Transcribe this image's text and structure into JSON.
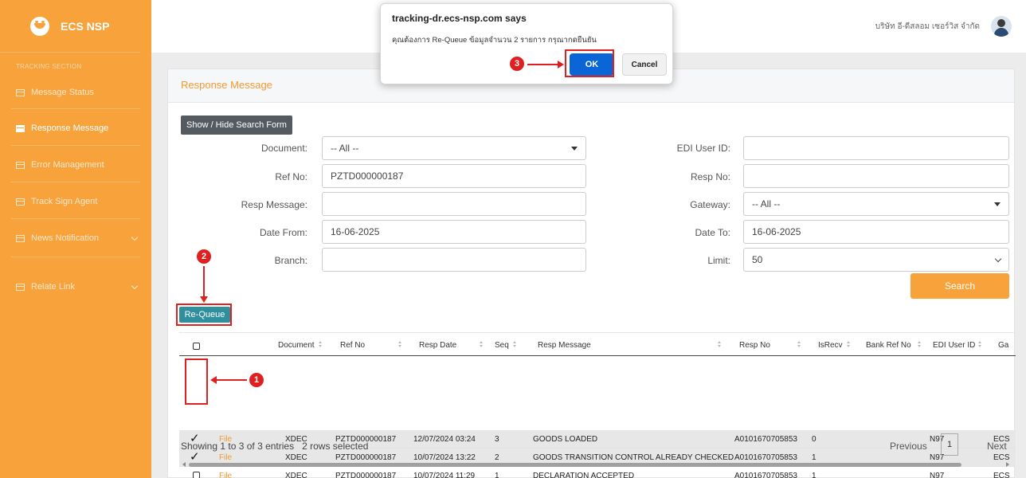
{
  "sidebar": {
    "brand": "ECS NSP",
    "section_title": "TRACKING SECTION",
    "items": [
      {
        "label": "Message Status"
      },
      {
        "label": "Response Message"
      },
      {
        "label": "Error Management"
      },
      {
        "label": "Track Sign Agent"
      },
      {
        "label": "News Notification"
      },
      {
        "label": "Relate Link"
      }
    ]
  },
  "header": {
    "company": "บริษัท อี-ดีสลอม เซอร์วิส จำกัด"
  },
  "card": {
    "title": "Response Message",
    "toggle_label": "Show / Hide Search Form"
  },
  "form": {
    "document": {
      "label": "Document:",
      "value": "-- All --"
    },
    "ref_no": {
      "label": "Ref No:",
      "value": "PZTD000000187"
    },
    "resp_message": {
      "label": "Resp Message:",
      "value": ""
    },
    "date_from": {
      "label": "Date From:",
      "value": "16-06-2025"
    },
    "branch": {
      "label": "Branch:",
      "value": ""
    },
    "edi_user_id": {
      "label": "EDI User ID:",
      "value": ""
    },
    "resp_no": {
      "label": "Resp No:",
      "value": ""
    },
    "gateway": {
      "label": "Gateway:",
      "value": "-- All --"
    },
    "date_to": {
      "label": "Date To:",
      "value": "16-06-2025"
    },
    "limit": {
      "label": "Limit:",
      "value": "50"
    },
    "search_label": "Search",
    "requeue_label": "Re-Queue"
  },
  "table": {
    "headers": {
      "document": "Document",
      "ref_no": "Ref No",
      "resp_date": "Resp Date",
      "seq": "Seq",
      "resp_message": "Resp Message",
      "resp_no": "Resp No",
      "isrecv": "IsRecv",
      "bank_ref_no": "Bank Ref No",
      "edi_user_id": "EDI User ID",
      "gateway": "Ga"
    },
    "rows": [
      {
        "link": "File",
        "document": "XDEC",
        "ref_no": "PZTD000000187",
        "resp_date": "12/07/2024 03:24",
        "seq": "3",
        "resp_message": "GOODS LOADED",
        "resp_no": "A0101670705853",
        "isrecv": "0",
        "bank_ref_no": "",
        "edi_user_id": "N97",
        "gateway": "ECS",
        "check": "✓"
      },
      {
        "link": "File",
        "document": "XDEC",
        "ref_no": "PZTD000000187",
        "resp_date": "10/07/2024 13:22",
        "seq": "2",
        "resp_message": "GOODS TRANSITION CONTROL ALREADY CHECKED",
        "resp_no": "A0101670705853",
        "isrecv": "1",
        "bank_ref_no": "",
        "edi_user_id": "N97",
        "gateway": "ECS",
        "check": "✓"
      },
      {
        "link": "File",
        "document": "XDEC",
        "ref_no": "PZTD000000187",
        "resp_date": "10/07/2024 11:29",
        "seq": "1",
        "resp_message": "DECLARATION ACCEPTED",
        "resp_no": "A0101670705853",
        "isrecv": "1",
        "bank_ref_no": "",
        "edi_user_id": "N97",
        "gateway": "ECS"
      }
    ]
  },
  "footer": {
    "info": "Showing 1 to 3 of 3 entries",
    "selected": "2 rows selected",
    "prev": "Previous",
    "page": "1",
    "next": "Next"
  },
  "dialog": {
    "title": "tracking-dr.ecs-nsp.com says",
    "message": "คุณต้องการ Re-Queue ข้อมูลจำนวน 2 รายการ กรุณากดยืนยัน",
    "ok": "OK",
    "cancel": "Cancel"
  },
  "annotations": {
    "step1": "1",
    "step2": "2",
    "step3": "3"
  },
  "colors": {
    "sidebar": "#f7a23a",
    "accent": "#f39a31",
    "requeue": "#2f8f9d",
    "ok_button": "#0a66d6",
    "annotation": "#e02020"
  }
}
